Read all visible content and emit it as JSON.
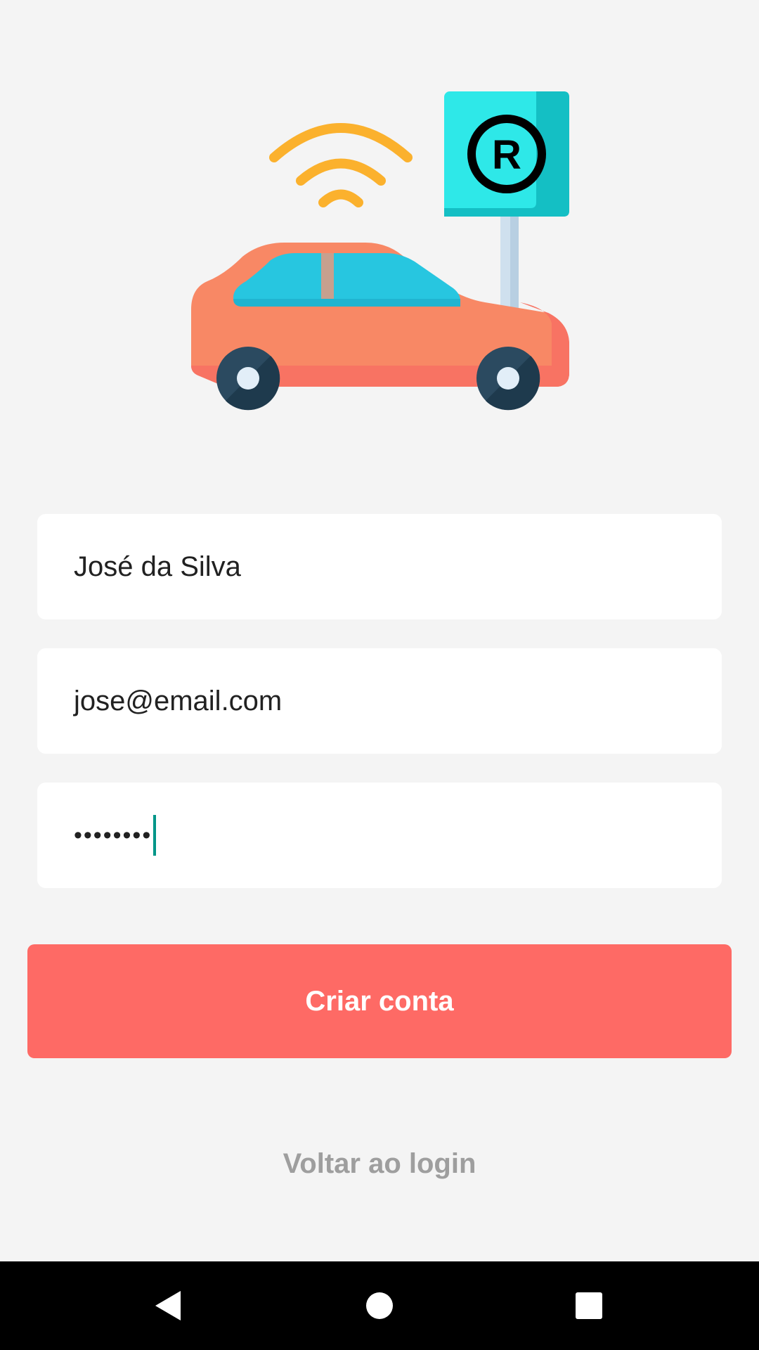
{
  "form": {
    "name_value": "José da Silva",
    "email_value": "jose@email.com",
    "password_masked": "••••••••"
  },
  "actions": {
    "create_account_label": "Criar conta",
    "back_to_login_label": "Voltar ao login"
  },
  "illustration": {
    "sign_letter": "R",
    "icons": [
      "car-icon",
      "wifi-signal-icon",
      "parking-sign-icon"
    ]
  },
  "navigation": {
    "icons": [
      "back-icon",
      "home-icon",
      "recents-icon"
    ]
  },
  "colors": {
    "background": "#f4f4f4",
    "primary_button": "#fe6a65",
    "link_text": "#9e9e9e",
    "caret": "#009688",
    "car_body": "#f88865",
    "car_window": "#27c6e0",
    "wifi": "#fbb12d",
    "sign": "#2ee8e8"
  }
}
